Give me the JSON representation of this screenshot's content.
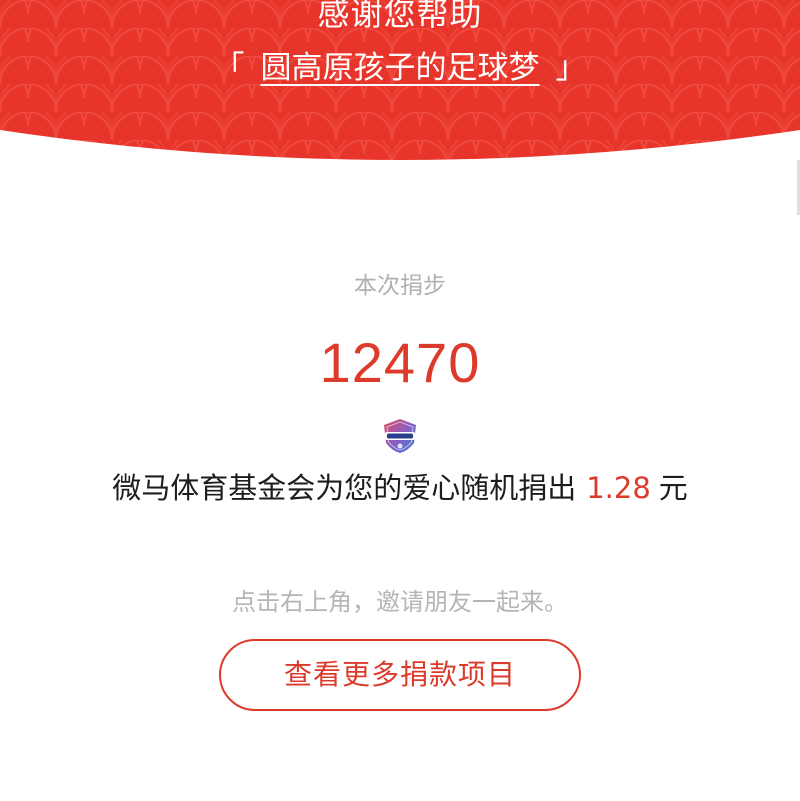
{
  "colors": {
    "brand_red": "#dc3b2b",
    "header_red": "#e8352b",
    "scale_red": "#f04a3e",
    "muted_gray": "#b0b0b0",
    "text_dark": "#1d1d1d"
  },
  "header": {
    "thanks": "感谢您帮助",
    "bracket_open": "「",
    "project_name": "圆高原孩子的足球梦",
    "bracket_close": "」",
    "background_pattern": "scale-wave-pattern"
  },
  "steps": {
    "label": "本次捐步",
    "value": "12470"
  },
  "foundation": {
    "badge_icon": "foundation-badge-icon",
    "sentence": "微马体育基金会为您的爱心随机捐出",
    "amount": "1.28",
    "unit": "元"
  },
  "hint": "点击右上角，邀请朋友一起来。",
  "more_button": "查看更多捐款项目"
}
